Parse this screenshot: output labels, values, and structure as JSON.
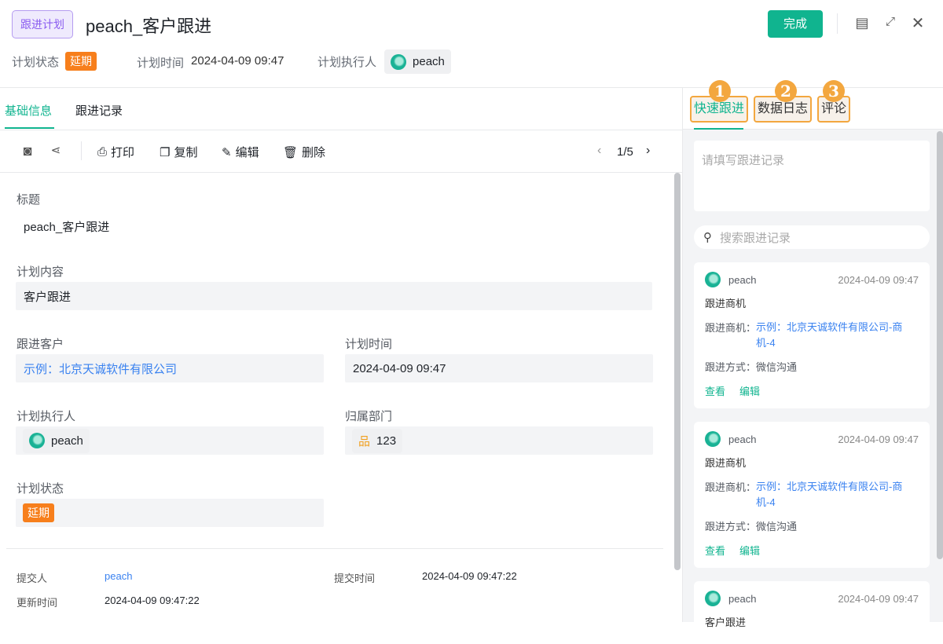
{
  "header": {
    "type_tag": "跟进计划",
    "title": "peach_客户跟进",
    "done_label": "完成",
    "status_label": "计划状态",
    "status_value": "延期",
    "time_label": "计划时间",
    "time_value": "2024-04-09 09:47",
    "owner_label": "计划执行人",
    "owner_value": "peach"
  },
  "tabs": [
    {
      "label": "基础信息"
    },
    {
      "label": "跟进记录"
    }
  ],
  "toolbar": {
    "print": "打印",
    "copy": "复制",
    "edit": "编辑",
    "delete": "删除",
    "pager": "1/5"
  },
  "fields": {
    "title_label": "标题",
    "title_value": "peach_客户跟进",
    "content_label": "计划内容",
    "content_value": "客户跟进",
    "customer_label": "跟进客户",
    "customer_value": "示例：北京天诚软件有限公司",
    "time_label": "计划时间",
    "time_value": "2024-04-09 09:47",
    "owner_label": "计划执行人",
    "owner_value": "peach",
    "dept_label": "归属部门",
    "dept_value": "123",
    "status_label": "计划状态",
    "status_value": "延期"
  },
  "footer": {
    "submitter_label": "提交人",
    "submitter_value": "peach",
    "submit_time_label": "提交时间",
    "submit_time_value": "2024-04-09 09:47:22",
    "update_time_label": "更新时间",
    "update_time_value": "2024-04-09 09:47:22"
  },
  "right": {
    "tabs": [
      {
        "num": "1",
        "label": "快速跟进"
      },
      {
        "num": "2",
        "label": "数据日志"
      },
      {
        "num": "3",
        "label": "评论"
      }
    ],
    "textarea_placeholder": "请填写跟进记录",
    "search_placeholder": "搜索跟进记录",
    "records": [
      {
        "user": "peach",
        "time": "2024-04-09 09:47",
        "title": "跟进商机",
        "opp_label": "跟进商机：",
        "opp_value": "示例：北京天诚软件有限公司-商机-4",
        "method_label": "跟进方式：",
        "method_value": "微信沟通",
        "view": "查看",
        "edit": "编辑"
      },
      {
        "user": "peach",
        "time": "2024-04-09 09:47",
        "title": "跟进商机",
        "opp_label": "跟进商机：",
        "opp_value": "示例：北京天诚软件有限公司-商机-4",
        "method_label": "跟进方式：",
        "method_value": "微信沟通",
        "view": "查看",
        "edit": "编辑"
      },
      {
        "user": "peach",
        "time": "2024-04-09 09:47",
        "title": "客户跟进"
      }
    ]
  },
  "colors": {
    "accent": "#10b48f",
    "warning": "#f77f1c",
    "link": "#3a82f0",
    "highlight": "#f3a73f"
  }
}
